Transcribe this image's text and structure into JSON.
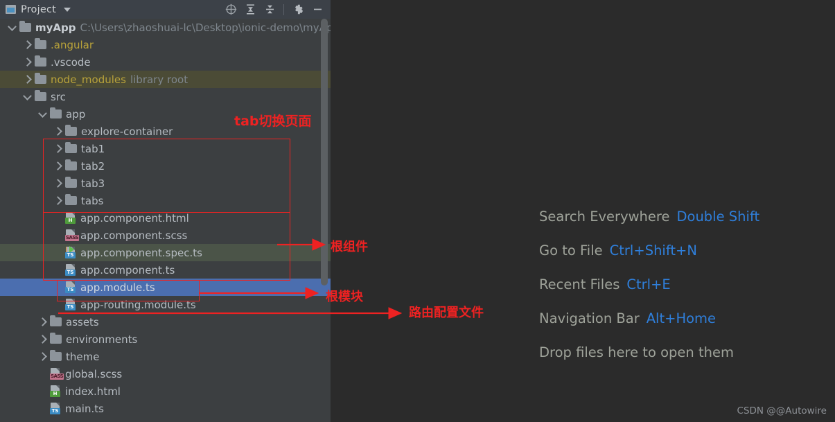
{
  "toolbar": {
    "title": "Project",
    "dropdown_icon": "chevron-down-icon",
    "buttons": [
      {
        "name": "select-opened-file-icon",
        "label": "Select Opened File"
      },
      {
        "name": "expand-all-icon",
        "label": "Expand All"
      },
      {
        "name": "collapse-all-icon",
        "label": "Collapse All"
      },
      {
        "name": "settings-gear-icon",
        "label": "Settings"
      },
      {
        "name": "hide-icon",
        "label": "Hide"
      }
    ]
  },
  "tree": {
    "items": [
      {
        "indent": 0,
        "twisty": "down",
        "kind": "folder",
        "label": "myApp",
        "style": "bold",
        "suffix": "C:\\Users\\zhaoshuai-lc\\Desktop\\ionic-demo\\myAp",
        "row": "plain"
      },
      {
        "indent": 1,
        "twisty": "right",
        "kind": "folder",
        "label": ".angular",
        "style": "yellow",
        "suffix": "",
        "row": "plain"
      },
      {
        "indent": 1,
        "twisty": "right",
        "kind": "folder",
        "label": ".vscode",
        "style": "",
        "suffix": "",
        "row": "plain"
      },
      {
        "indent": 1,
        "twisty": "right",
        "kind": "folder",
        "label": "node_modules",
        "style": "yellow",
        "suffix": "library root",
        "row": "hl-node"
      },
      {
        "indent": 1,
        "twisty": "down",
        "kind": "folder",
        "label": "src",
        "style": "",
        "suffix": "",
        "row": "plain"
      },
      {
        "indent": 2,
        "twisty": "down",
        "kind": "folder",
        "label": "app",
        "style": "",
        "suffix": "",
        "row": "plain"
      },
      {
        "indent": 3,
        "twisty": "right",
        "kind": "folder",
        "label": "explore-container",
        "style": "",
        "suffix": "",
        "row": "plain"
      },
      {
        "indent": 3,
        "twisty": "right",
        "kind": "folder",
        "label": "tab1",
        "style": "",
        "suffix": "",
        "row": "plain"
      },
      {
        "indent": 3,
        "twisty": "right",
        "kind": "folder",
        "label": "tab2",
        "style": "",
        "suffix": "",
        "row": "plain"
      },
      {
        "indent": 3,
        "twisty": "right",
        "kind": "folder",
        "label": "tab3",
        "style": "",
        "suffix": "",
        "row": "plain"
      },
      {
        "indent": 3,
        "twisty": "right",
        "kind": "folder",
        "label": "tabs",
        "style": "",
        "suffix": "",
        "row": "plain"
      },
      {
        "indent": 3,
        "twisty": "none",
        "kind": "file",
        "badge": "H",
        "label": "app.component.html",
        "style": "",
        "suffix": "",
        "row": "plain"
      },
      {
        "indent": 3,
        "twisty": "none",
        "kind": "file",
        "badge": "SASS",
        "label": "app.component.scss",
        "style": "",
        "suffix": "",
        "row": "plain"
      },
      {
        "indent": 3,
        "twisty": "none",
        "kind": "file",
        "badge": "TS",
        "run": true,
        "label": "app.component.spec.ts",
        "style": "",
        "suffix": "",
        "row": "hl-spec"
      },
      {
        "indent": 3,
        "twisty": "none",
        "kind": "file",
        "badge": "TS",
        "label": "app.component.ts",
        "style": "",
        "suffix": "",
        "row": "plain"
      },
      {
        "indent": 3,
        "twisty": "none",
        "kind": "file",
        "badge": "TS",
        "label": "app.module.ts",
        "style": "sel",
        "suffix": "",
        "row": "hl-sel"
      },
      {
        "indent": 3,
        "twisty": "none",
        "kind": "file",
        "badge": "TS",
        "label": "app-routing.module.ts",
        "style": "",
        "suffix": "",
        "row": "plain"
      },
      {
        "indent": 2,
        "twisty": "right",
        "kind": "folder",
        "label": "assets",
        "style": "",
        "suffix": "",
        "row": "plain"
      },
      {
        "indent": 2,
        "twisty": "right",
        "kind": "folder",
        "label": "environments",
        "style": "",
        "suffix": "",
        "row": "plain"
      },
      {
        "indent": 2,
        "twisty": "right",
        "kind": "folder",
        "label": "theme",
        "style": "",
        "suffix": "",
        "row": "plain"
      },
      {
        "indent": 2,
        "twisty": "none",
        "kind": "file",
        "badge": "SASS",
        "label": "global.scss",
        "style": "",
        "suffix": "",
        "row": "plain"
      },
      {
        "indent": 2,
        "twisty": "none",
        "kind": "file",
        "badge": "H",
        "label": "index.html",
        "style": "",
        "suffix": "",
        "row": "plain"
      },
      {
        "indent": 2,
        "twisty": "none",
        "kind": "file",
        "badge": "TS",
        "label": "main.ts",
        "style": "",
        "suffix": "",
        "row": "plain"
      }
    ]
  },
  "shortcuts": [
    {
      "name": "Search Everywhere",
      "key": "Double Shift"
    },
    {
      "name": "Go to File",
      "key": "Ctrl+Shift+N"
    },
    {
      "name": "Recent Files",
      "key": "Ctrl+E"
    },
    {
      "name": "Navigation Bar",
      "key": "Alt+Home"
    },
    {
      "name": "Drop files here to open them",
      "key": ""
    }
  ],
  "watermark": "CSDN @@Autowire",
  "annotations": {
    "color": "#ee2222",
    "labels": {
      "tabs": "tab切换页面",
      "root_component": "根组件",
      "root_module": "根模块",
      "routing_config": "路由配置文件"
    }
  }
}
